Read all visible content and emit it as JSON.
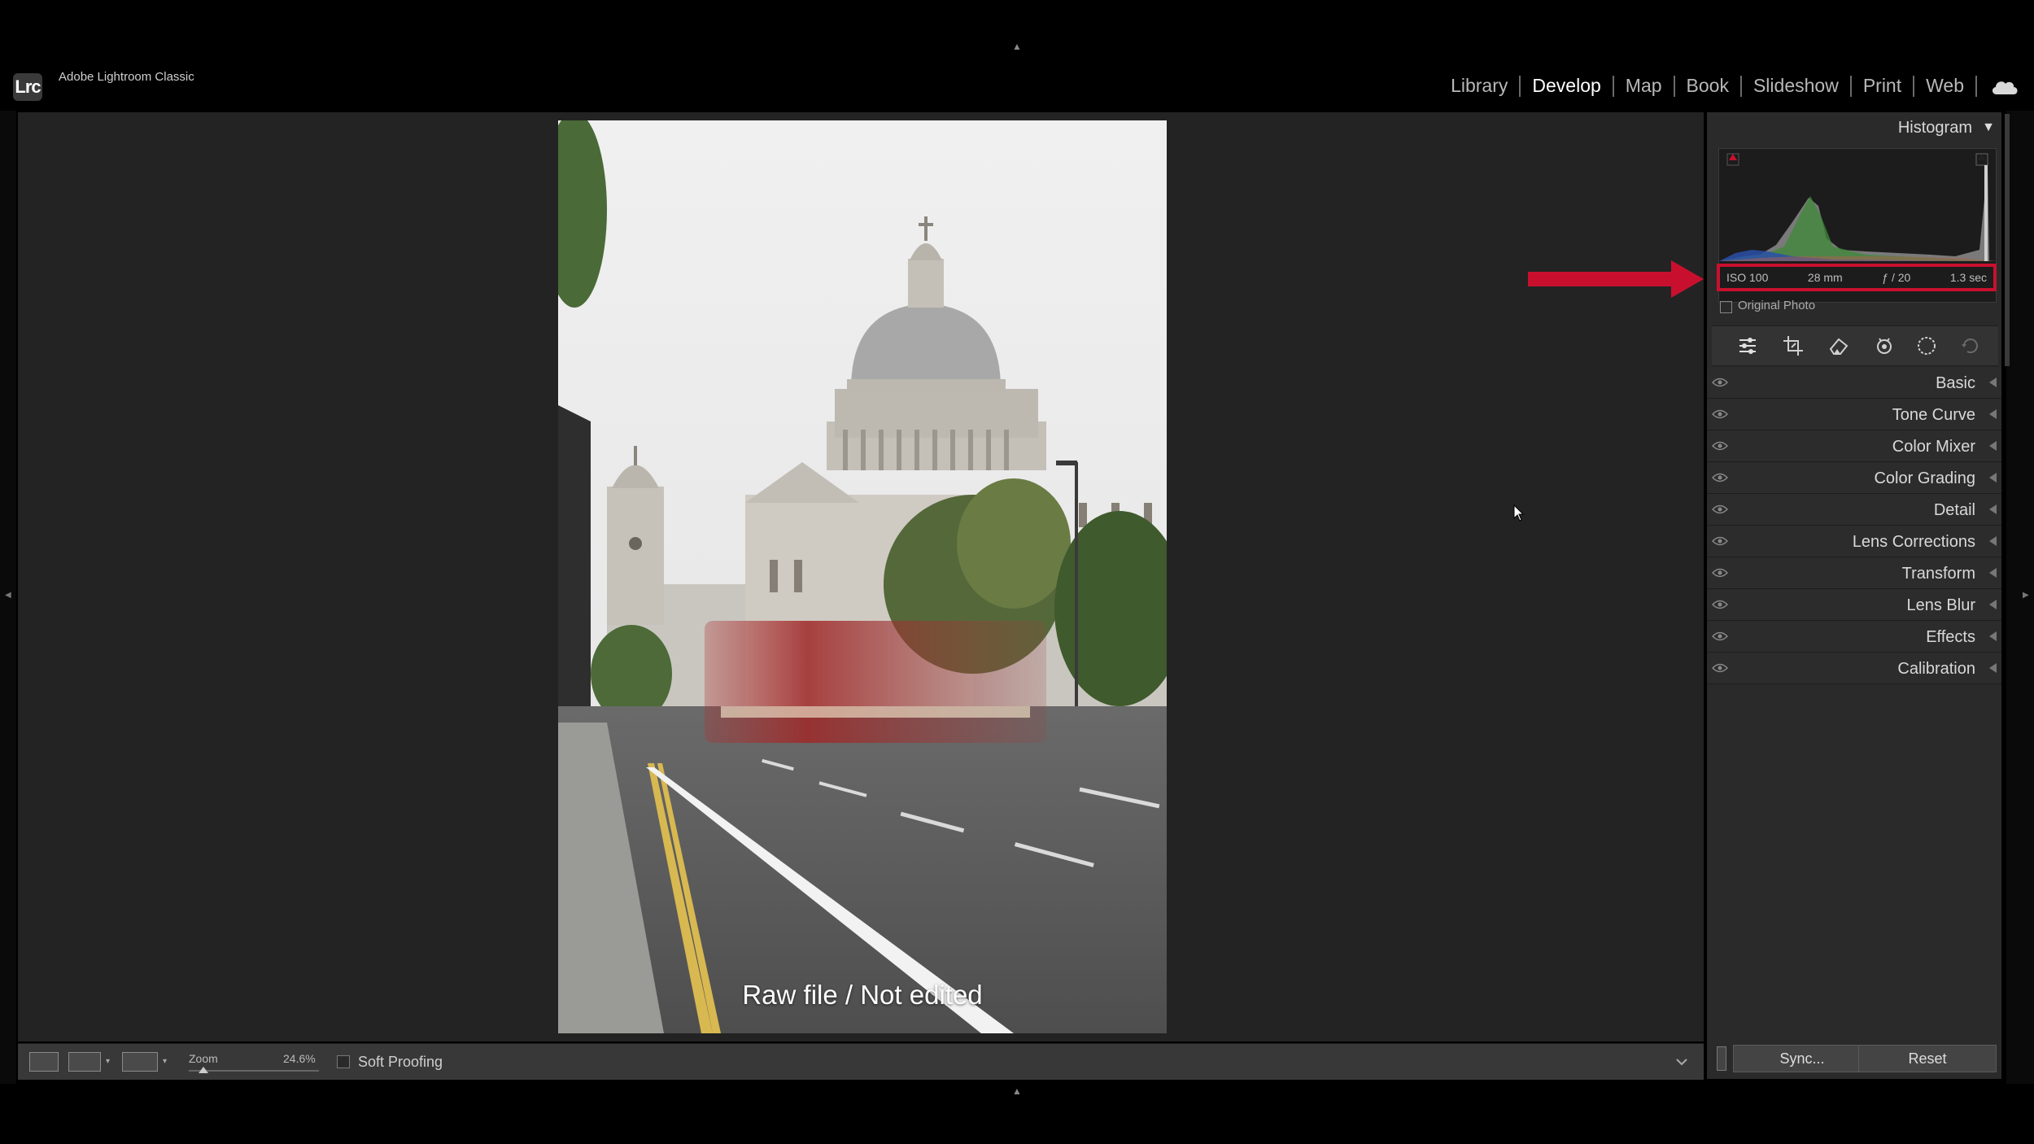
{
  "app": {
    "logo": "Lrc",
    "title": "Adobe Lightroom Classic"
  },
  "modules": [
    {
      "label": "Library",
      "active": false
    },
    {
      "label": "Develop",
      "active": true
    },
    {
      "label": "Map",
      "active": false
    },
    {
      "label": "Book",
      "active": false
    },
    {
      "label": "Slideshow",
      "active": false
    },
    {
      "label": "Print",
      "active": false
    },
    {
      "label": "Web",
      "active": false
    }
  ],
  "canvas": {
    "caption": "Raw file / Not edited"
  },
  "toolbar": {
    "zoom_label": "Zoom",
    "zoom_value": "24.6%",
    "soft_proofing_label": "Soft Proofing",
    "soft_proofing_checked": false
  },
  "histogram": {
    "title": "Histogram",
    "exif": {
      "iso": "ISO 100",
      "focal_length": "28 mm",
      "aperture": "ƒ / 20",
      "shutter": "1.3 sec"
    },
    "original_photo_label": "Original Photo",
    "highlight_color": "#c8102e"
  },
  "tools": [
    "edit-sliders-icon",
    "crop-icon",
    "healing-eraser-icon",
    "red-eye-icon",
    "masking-icon",
    "history-icon"
  ],
  "panels": [
    "Basic",
    "Tone Curve",
    "Color Mixer",
    "Color Grading",
    "Detail",
    "Lens Corrections",
    "Transform",
    "Lens Blur",
    "Effects",
    "Calibration"
  ],
  "buttons": {
    "sync": "Sync...",
    "reset": "Reset"
  }
}
